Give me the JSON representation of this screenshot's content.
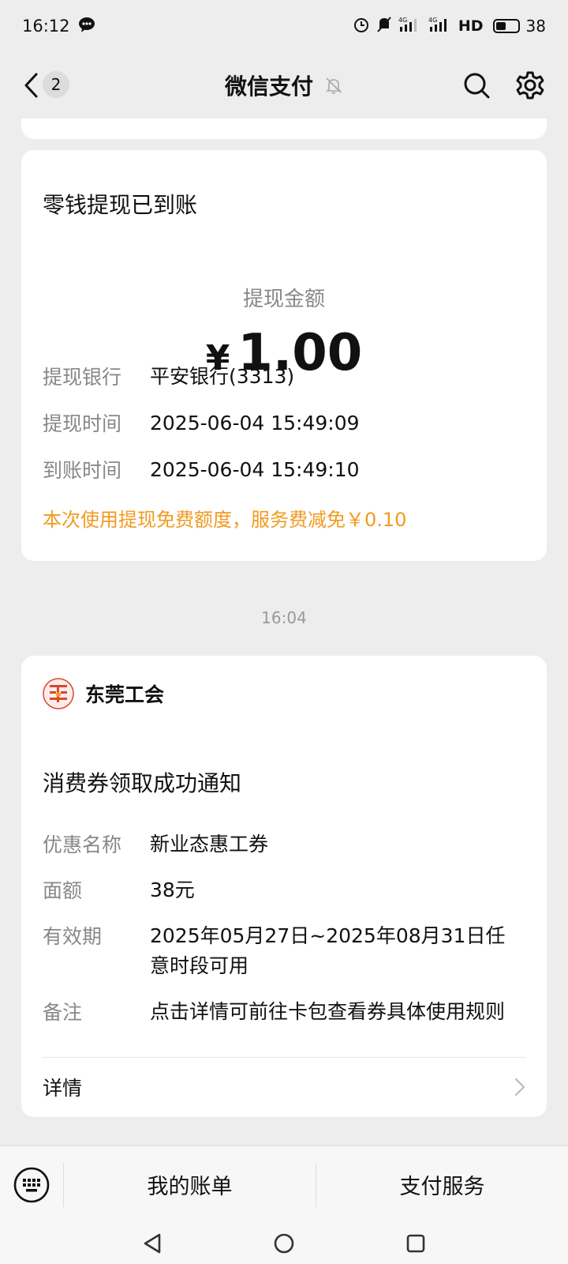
{
  "status_bar": {
    "time": "16:12",
    "net_left": "4G",
    "net_right": "4G",
    "hd": "HD",
    "battery": "38"
  },
  "header": {
    "unread_count": "2",
    "title": "微信支付"
  },
  "withdraw_card": {
    "title": "零钱提现已到账",
    "amount_label": "提现金额",
    "currency": "¥",
    "amount": "1.00",
    "rows": [
      {
        "key": "提现银行",
        "value": "平安银行(3313)"
      },
      {
        "key": "提现时间",
        "value": "2025-06-04 15:49:09"
      },
      {
        "key": "到账时间",
        "value": "2025-06-04 15:49:10"
      }
    ],
    "notice": "本次使用提现免费额度，服务费减免￥0.10"
  },
  "timestamp": "16:04",
  "voucher_card": {
    "org_name": "东莞工会",
    "title": "消费券领取成功通知",
    "rows": [
      {
        "key": "优惠名称",
        "value": "新业态惠工券"
      },
      {
        "key": "面额",
        "value": "38元"
      },
      {
        "key": "有效期",
        "value_line1": "2025年05月27日~2025年08月31日任",
        "value_line2": "意时段可用"
      },
      {
        "key": "备注",
        "value": "点击详情可前往卡包查看券具体使用规则"
      }
    ],
    "details_label": "详情"
  },
  "bottom_menu": {
    "items": [
      "我的账单",
      "支付服务"
    ]
  },
  "colors": {
    "background": "#ededed",
    "card": "#ffffff",
    "notice": "#f29a1f",
    "muted": "#888888"
  }
}
